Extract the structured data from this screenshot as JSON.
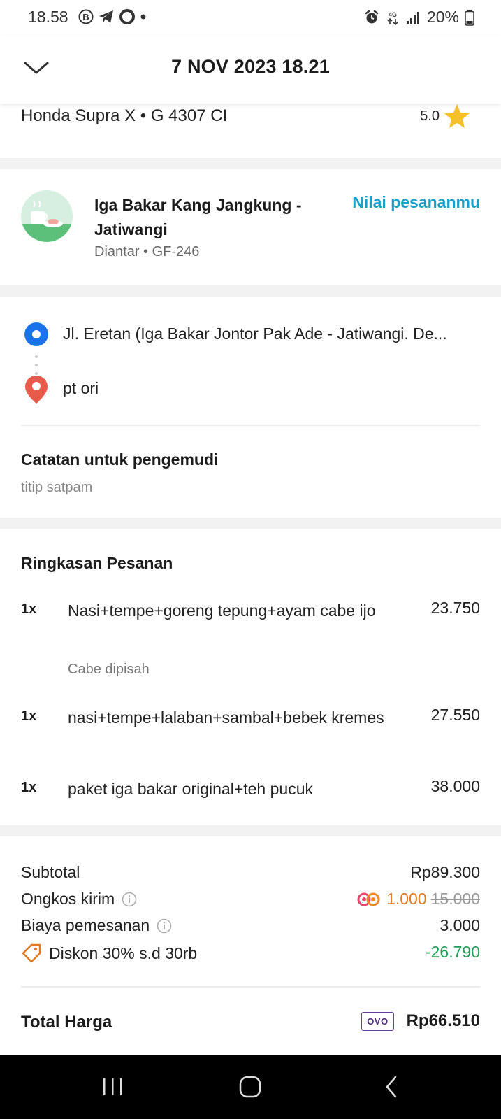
{
  "status_bar": {
    "time": "18.58",
    "network": "4G",
    "battery": "20%"
  },
  "header": {
    "title": "7 NOV 2023 18.21"
  },
  "driver": {
    "vehicle": "Honda Supra X • G 4307 CI",
    "rating": "5.0"
  },
  "restaurant": {
    "name": "Iga Bakar Kang Jangkung - Jatiwangi",
    "subtitle": "Diantar • GF-246",
    "rate_label": "Nilai pesananmu"
  },
  "route": {
    "pickup": "Jl. Eretan (Iga Bakar Jontor Pak Ade - Jatiwangi. De...",
    "destination": "pt ori"
  },
  "notes": {
    "title": "Catatan untuk pengemudi",
    "text": "titip satpam"
  },
  "summary": {
    "title": "Ringkasan Pesanan",
    "items": [
      {
        "qty": "1x",
        "name": "Nasi+tempe+goreng tepung+ayam cabe ijo",
        "price": "23.750",
        "note": "Cabe dipisah"
      },
      {
        "qty": "1x",
        "name": "nasi+tempe+lalaban+sambal+bebek kremes",
        "price": "27.550"
      },
      {
        "qty": "1x",
        "name": "paket iga bakar original+teh pucuk",
        "price": "38.000"
      }
    ]
  },
  "totals": {
    "subtotal_label": "Subtotal",
    "subtotal_value": "Rp89.300",
    "delivery_label": "Ongkos kirim",
    "delivery_value": "1.000",
    "delivery_original": "15.000",
    "fee_label": "Biaya pemesanan",
    "fee_value": "3.000",
    "discount_label": "Diskon 30% s.d 30rb",
    "discount_value": "-26.790",
    "total_label": "Total Harga",
    "payment_method": "OVO",
    "total_value": "Rp66.510"
  },
  "colors": {
    "accent_link": "#1aa0c8",
    "promo": "#e07a1f",
    "discount": "#1fa055",
    "pickup_dot": "#1a73e8",
    "destination_pin": "#e85b4a"
  }
}
